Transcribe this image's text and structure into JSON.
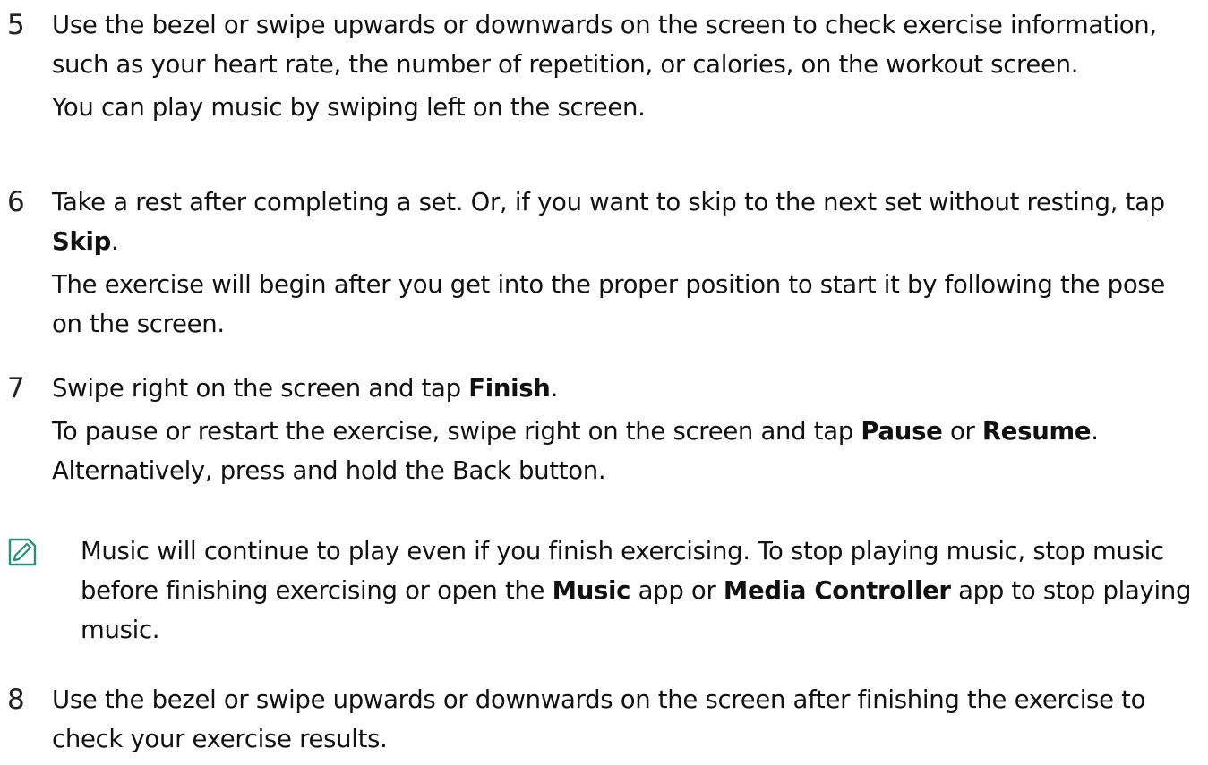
{
  "steps": [
    {
      "number": "5",
      "main": "Use the bezel or swipe upwards or downwards on the screen to check exercise information, such as your heart rate, the number of repetition, or calories, on the workout screen.",
      "sub": "You can play music by swiping left on the screen."
    },
    {
      "number": "6",
      "main_before": "Take a rest after completing a set. Or, if you want to skip to the next set without resting, tap ",
      "main_bold": "Skip",
      "main_after": ".",
      "sub": "The exercise will begin after you get into the proper position to start it by following the pose on the screen."
    },
    {
      "number": "7",
      "main_before": "Swipe right on the screen and tap ",
      "main_bold": "Finish",
      "main_after": ".",
      "sub_before": "To pause or restart the exercise, swipe right on the screen and tap ",
      "sub_bold1": "Pause",
      "sub_mid": " or ",
      "sub_bold2": "Resume",
      "sub_after": ". Alternatively, press and hold the Back button."
    },
    {
      "number": "8",
      "main": "Use the bezel or swipe upwards or downwards on the screen after finishing the exercise to check your exercise results."
    }
  ],
  "note": {
    "icon": "note-pencil-icon",
    "text_before": "Music will continue to play even if you finish exercising. To stop playing music, stop music before finishing exercising or open the ",
    "bold1": "Music",
    "mid": " app or ",
    "bold2": "Media Controller",
    "text_after": " app to stop playing music."
  },
  "colors": {
    "text": "#111111",
    "icon": "#2a8f7a"
  }
}
